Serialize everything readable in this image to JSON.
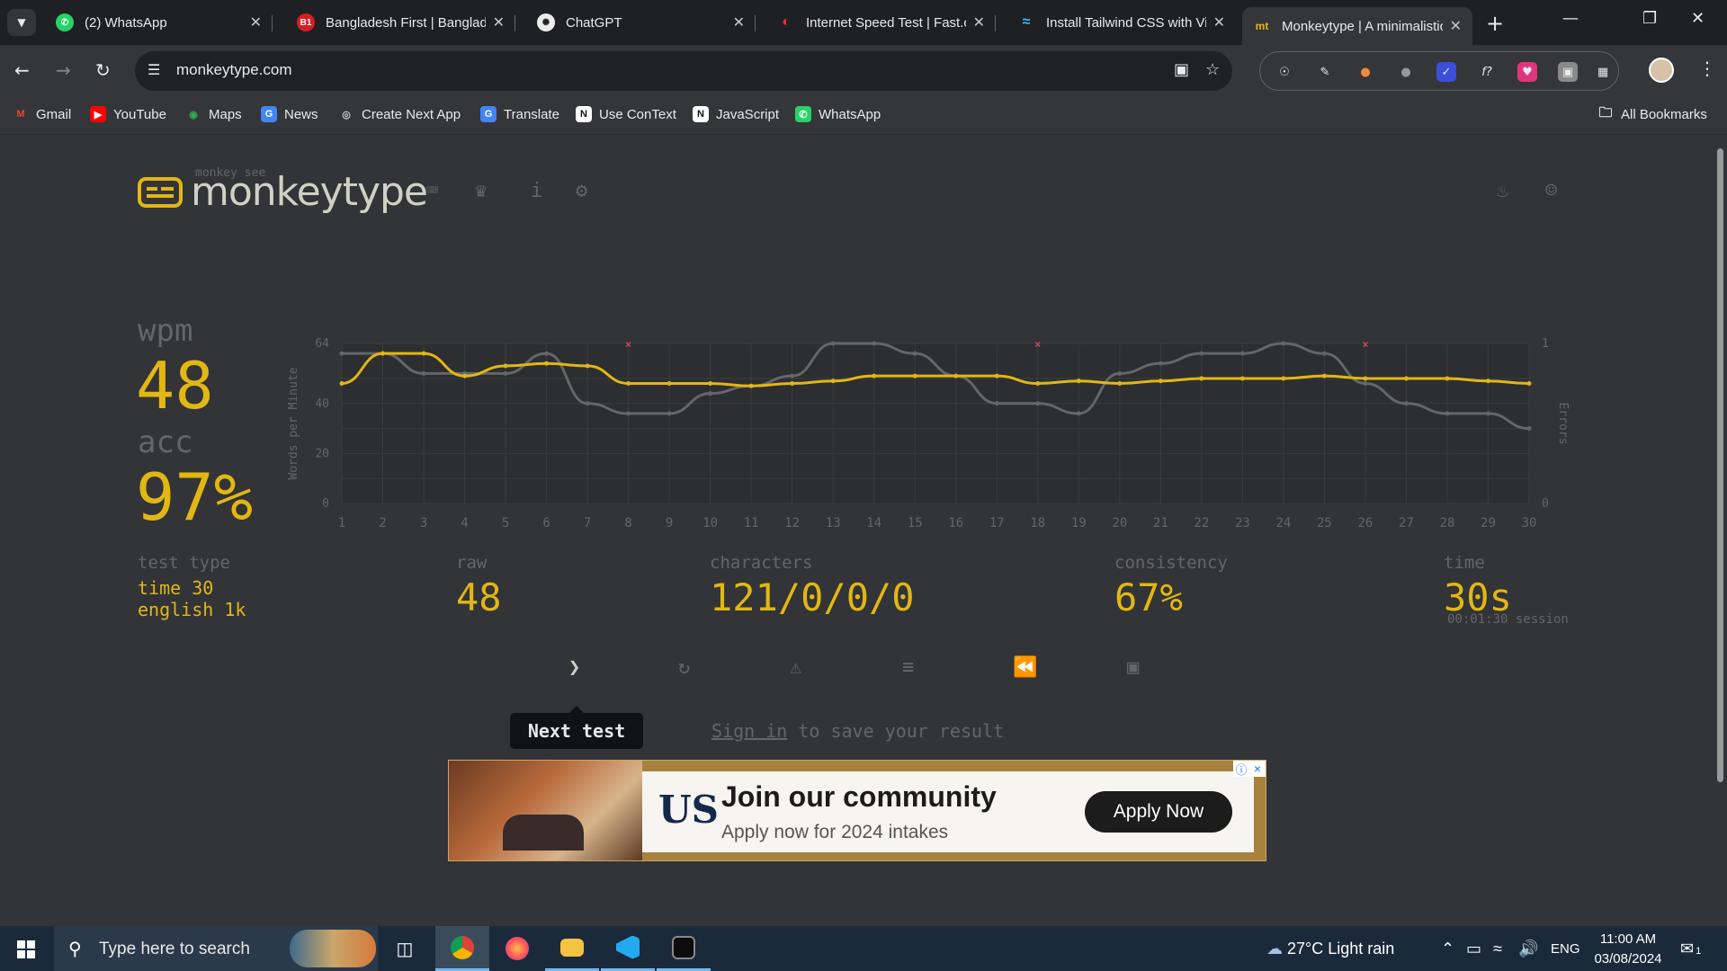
{
  "browser": {
    "tabs": [
      {
        "title": "(2) WhatsApp"
      },
      {
        "title": "Bangladesh First | Bangladesh"
      },
      {
        "title": "ChatGPT"
      },
      {
        "title": "Internet Speed Test | Fast.com"
      },
      {
        "title": "Install Tailwind CSS with Vite"
      },
      {
        "title": "Monkeytype | A minimalistic"
      }
    ],
    "url": "monkeytype.com",
    "bookmarks": [
      "Gmail",
      "YouTube",
      "Maps",
      "News",
      "Create Next App",
      "Translate",
      "Use ConText",
      "JavaScript",
      "WhatsApp"
    ],
    "all_bookmarks": "All Bookmarks"
  },
  "site": {
    "logo_small": "monkey see",
    "logo_text": "monkeytype"
  },
  "result": {
    "wpm_label": "wpm",
    "wpm": "48",
    "acc_label": "acc",
    "acc": "97%",
    "test_type_label": "test type",
    "test_type_1": "time 30",
    "test_type_2": "english 1k",
    "raw_label": "raw",
    "raw": "48",
    "characters_label": "characters",
    "characters": "121/0/0/0",
    "consistency_label": "consistency",
    "consistency": "67%",
    "time_label": "time",
    "time": "30s",
    "session": "00:01:30 session"
  },
  "actions": {
    "tooltip": "Next test",
    "sign_in": "Sign in",
    "save_text": " to save your result"
  },
  "ad": {
    "logo": "US",
    "title": "Join our community",
    "subtitle": "Apply now for 2024 intakes",
    "button": "Apply Now"
  },
  "taskbar": {
    "search_placeholder": "Type here to search",
    "weather": "27°C  Light rain",
    "lang": "ENG",
    "time": "11:00 AM",
    "date": "03/08/2024",
    "notif_count": "1"
  },
  "colors": {
    "accent": "#e2b714",
    "sub": "#646669",
    "bg": "#323437",
    "error": "#ca4754"
  },
  "chart_data": {
    "type": "line",
    "x": [
      1,
      2,
      3,
      4,
      5,
      6,
      7,
      8,
      9,
      10,
      11,
      12,
      13,
      14,
      15,
      16,
      17,
      18,
      19,
      20,
      21,
      22,
      23,
      24,
      25,
      26,
      27,
      28,
      29,
      30
    ],
    "ylabel": "Words per Minute",
    "y2label": "Errors",
    "ylim": [
      0,
      64
    ],
    "y2lim": [
      0,
      1
    ],
    "yticks": [
      0,
      20,
      40,
      64
    ],
    "y2ticks": [
      0,
      1
    ],
    "grid": true,
    "series": [
      {
        "name": "wpm",
        "color": "#e2b714",
        "values": [
          48,
          60,
          60,
          51,
          55,
          56,
          55,
          48,
          48,
          48,
          47,
          48,
          49,
          51,
          51,
          51,
          51,
          48,
          49,
          48,
          49,
          50,
          50,
          50,
          51,
          50,
          50,
          50,
          49,
          48
        ]
      },
      {
        "name": "raw",
        "color": "#646669",
        "values": [
          60,
          60,
          52,
          52,
          52,
          60,
          40,
          36,
          36,
          44,
          47,
          51,
          64,
          64,
          60,
          51,
          40,
          40,
          36,
          52,
          56,
          60,
          60,
          64,
          60,
          48,
          40,
          36,
          36,
          30
        ]
      }
    ],
    "errors": [
      8,
      18,
      26
    ]
  }
}
